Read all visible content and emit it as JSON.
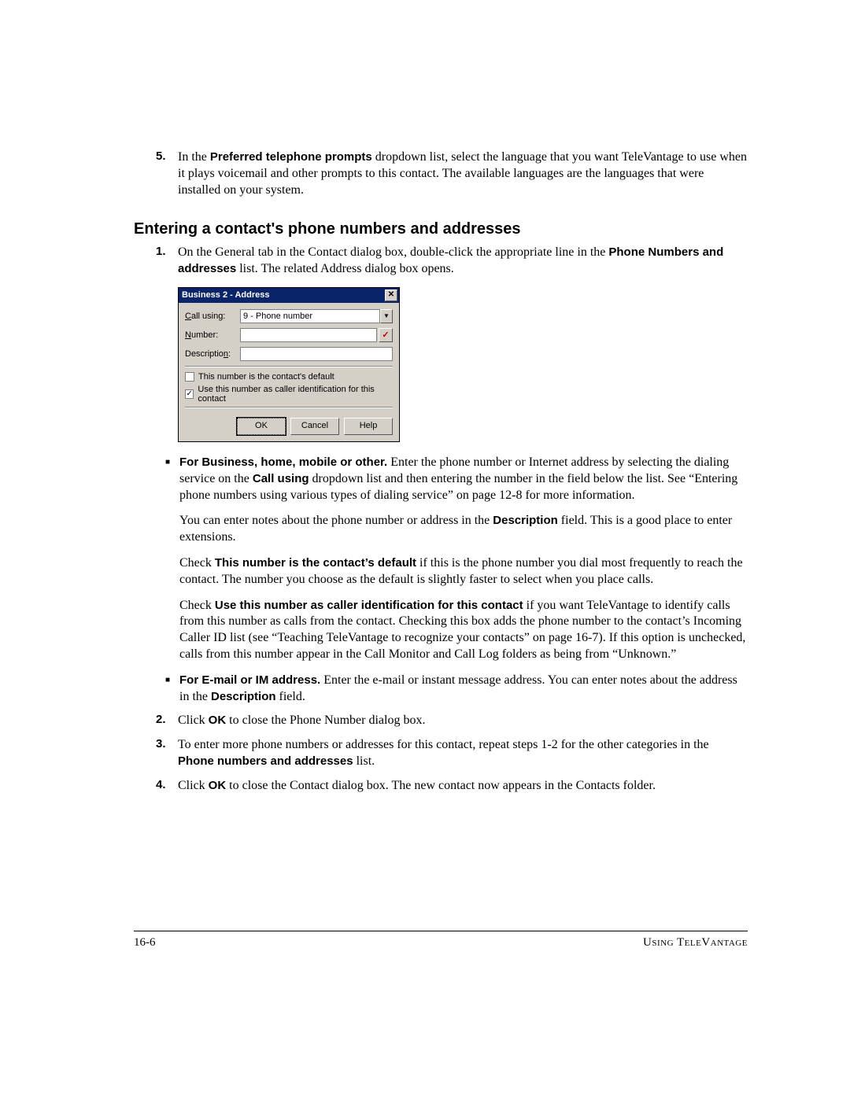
{
  "step5": {
    "num": "5.",
    "pre": "In the ",
    "bold": "Preferred telephone prompts",
    "post": " dropdown list, select the language that you want TeleVantage to use when it plays voicemail and other prompts to this contact. The available languages are the languages that were installed on your system."
  },
  "section_heading": "Entering a contact's phone numbers and addresses",
  "step1": {
    "num": "1.",
    "text1": "On the General tab in the Contact dialog box, double-click the appropriate line in the ",
    "bold": "Phone Numbers and addresses",
    "text2": " list. The related Address dialog box opens."
  },
  "dialog": {
    "title": "Business 2 - Address",
    "labels": {
      "call_using": "Call using:",
      "number": "Number:",
      "description": "Description:"
    },
    "call_using_value": "9 - Phone number",
    "cb1": "This number is the contact's default",
    "cb1_checked": false,
    "cb2": "Use this number as caller identification for this contact",
    "cb2_checked": true,
    "buttons": {
      "ok": "OK",
      "cancel": "Cancel",
      "help": "Help"
    }
  },
  "bullet1": {
    "lead": "For Business, home, mobile or other.",
    "t1": " Enter the phone number or Internet address by selecting the dialing service on the ",
    "b1": "Call using",
    "t2": " dropdown list and then entering the number in the field below the list. See “Entering phone numbers using various types of dialing service” on page 12-8 for more information."
  },
  "para_desc": {
    "t1": "You can enter notes about the phone number or address in the ",
    "b1": "Description",
    "t2": " field. This is a good place to enter extensions."
  },
  "para_default": {
    "t1": "Check ",
    "b1": "This number is the contact’s default",
    "t2": " if this is the phone number you dial most frequently to reach the contact. The number you choose as the default is slightly faster to select when you place calls."
  },
  "para_callerid": {
    "t1": "Check ",
    "b1": "Use this number as caller identification for this contact",
    "t2": " if you want TeleVantage to identify calls from this number as calls from the contact. Checking this box adds the phone number to the contact’s Incoming Caller ID list (see “Teaching TeleVantage to recognize your contacts” on page 16-7). If this option is unchecked, calls from this number appear in the Call Monitor and Call Log folders as being from “Unknown.”"
  },
  "bullet2": {
    "lead": "For E-mail or IM address.",
    "t1": " Enter the e-mail or instant message address. You can enter notes about the address in the ",
    "b1": "Description",
    "t2": " field."
  },
  "step2": {
    "num": "2.",
    "t1": "Click ",
    "b1": "OK",
    "t2": " to close the Phone Number dialog box."
  },
  "step3": {
    "num": "3.",
    "t1": "To enter more phone numbers or addresses for this contact, repeat steps 1-2 for the other categories in the ",
    "b1": "Phone numbers and addresses",
    "t2": " list."
  },
  "step4": {
    "num": "4.",
    "t1": "Click ",
    "b1": "OK",
    "t2": " to close the Contact dialog box. The new contact now appears in the Contacts folder."
  },
  "footer": {
    "left": "16-6",
    "right": "Using TeleVantage"
  }
}
